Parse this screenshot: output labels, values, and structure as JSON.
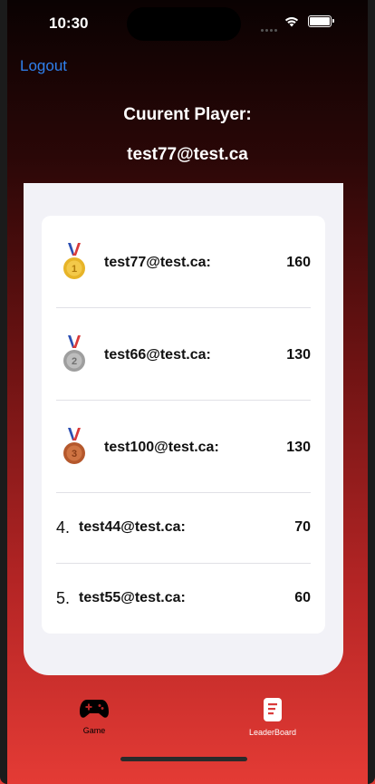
{
  "status_bar": {
    "time": "10:30"
  },
  "nav": {
    "logout_label": "Logout"
  },
  "header": {
    "line1": "Cuurent Player:",
    "line2": "test77@test.ca"
  },
  "leaderboard": {
    "rows": [
      {
        "rank": "1",
        "email": "test77@test.ca:",
        "score": "160",
        "medal": "gold-medal-icon"
      },
      {
        "rank": "2",
        "email": "test66@test.ca:",
        "score": "130",
        "medal": "silver-medal-icon"
      },
      {
        "rank": "3",
        "email": "test100@test.ca:",
        "score": "130",
        "medal": "bronze-medal-icon"
      },
      {
        "rank": "4.",
        "email": "test44@test.ca:",
        "score": "70"
      },
      {
        "rank": "5.",
        "email": "test55@test.ca:",
        "score": "60"
      }
    ]
  },
  "tab_bar": {
    "tabs": [
      {
        "label": "Game",
        "icon": "gamepad-icon",
        "active": false
      },
      {
        "label": "LeaderBoard",
        "icon": "leaderboard-icon",
        "active": true
      }
    ]
  },
  "colors": {
    "accent": "#2f80ed",
    "gold": "#e7b428",
    "silver": "#9e9e9e",
    "bronze": "#b5582c"
  }
}
